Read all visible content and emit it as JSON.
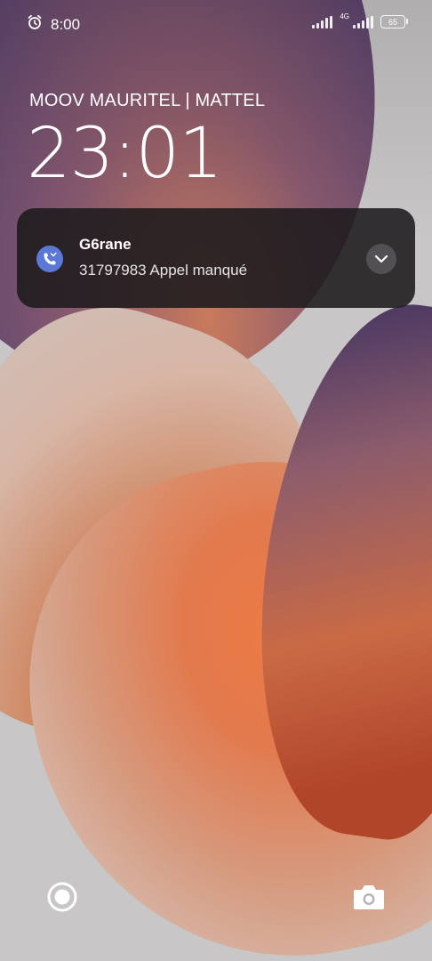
{
  "status_bar": {
    "time": "8:00",
    "alarm_icon": "alarm-clock-icon",
    "network_type": "4G",
    "battery_level": "65"
  },
  "lock_screen": {
    "carrier": "MOOV MAURITEL | MATTEL",
    "clock": "23:01"
  },
  "notification": {
    "app_icon": "missed-call-icon",
    "title": "G6rane",
    "body": "31797983 Appel manqué",
    "expand_icon": "chevron-down-icon",
    "icon_color": "#5a78d6"
  },
  "shortcuts": {
    "left_icon": "record-icon",
    "right_icon": "camera-icon"
  }
}
